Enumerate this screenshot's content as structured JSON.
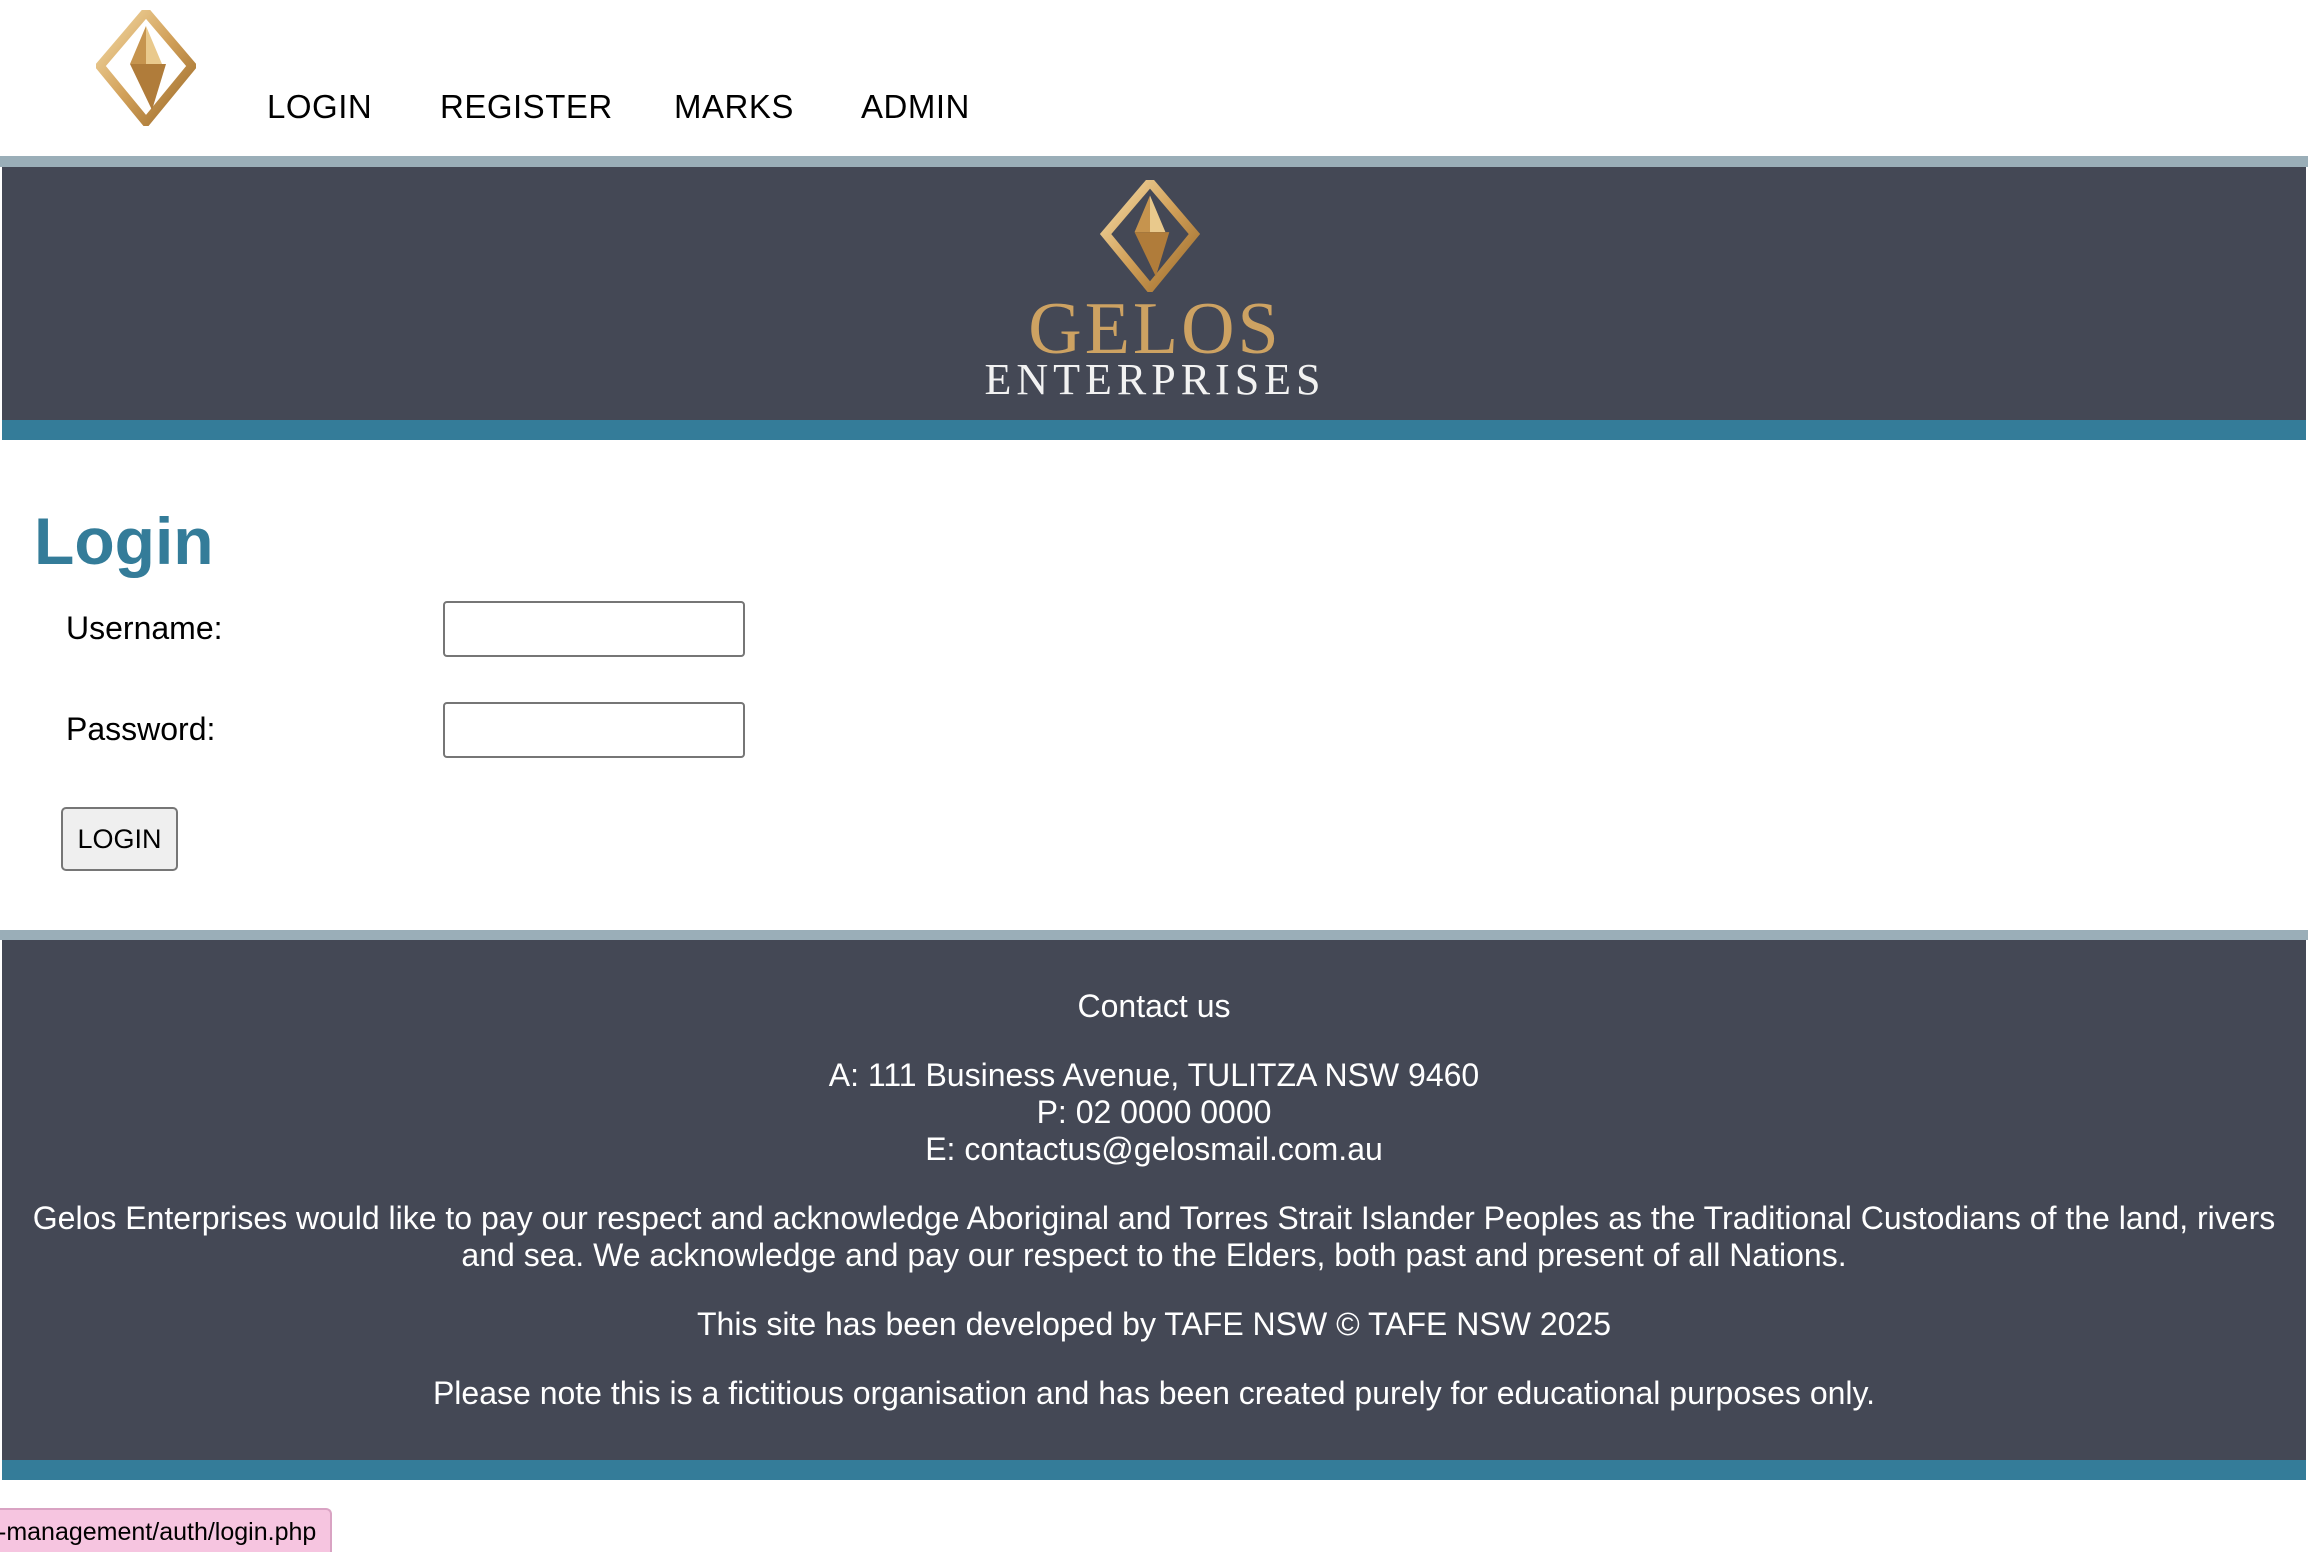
{
  "nav": {
    "items": [
      {
        "label": "LOGIN"
      },
      {
        "label": "REGISTER"
      },
      {
        "label": "MARKS"
      },
      {
        "label": "ADMIN"
      }
    ]
  },
  "banner": {
    "brand_line1": "GELOS",
    "brand_line2": "ENTERPRISES"
  },
  "login": {
    "title": "Login",
    "username_label": "Username:",
    "username_value": "",
    "password_label": "Password:",
    "password_value": "",
    "button_label": "LOGIN"
  },
  "footer": {
    "contact_heading": "Contact us",
    "address": "A: 111 Business Avenue, TULITZA NSW 9460",
    "phone": "P: 02 0000 0000",
    "email": "E: contactus@gelosmail.com.au",
    "acknowledgement": "Gelos Enterprises would like to pay our respect and acknowledge Aboriginal and Torres Strait Islander Peoples as the Traditional Custodians of the land, rivers and sea. We acknowledge and pay our respect to the Elders, both past and present of all Nations.",
    "developed_by": "This site has been developed by TAFE NSW © TAFE NSW 2025",
    "disclaimer": "Please note this is a fictitious organisation and has been created purely for educational purposes only."
  },
  "status_bar": {
    "url": "-management/auth/login.php"
  },
  "colors": {
    "accent": "#347c99",
    "banner_bg": "#444855",
    "gold": "#cda262",
    "divider": "#9aaeb8"
  },
  "icons": {
    "logo": "gelos-diamond-logo-icon"
  }
}
